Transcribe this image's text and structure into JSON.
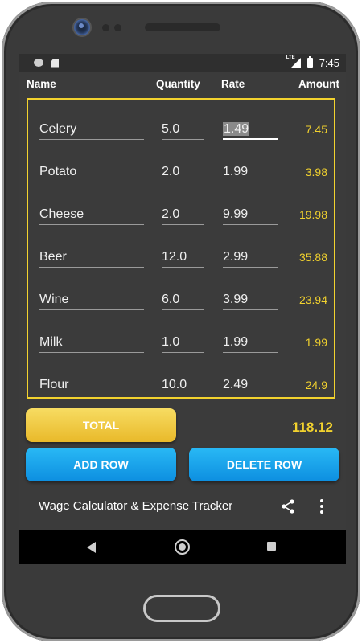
{
  "status_bar": {
    "time": "7:45",
    "signal": "LTE"
  },
  "columns": {
    "name": "Name",
    "quantity": "Quantity",
    "rate": "Rate",
    "amount": "Amount"
  },
  "rows": [
    {
      "name": "Celery",
      "quantity": "5.0",
      "rate": "1.49",
      "amount": "7.45"
    },
    {
      "name": "Potato",
      "quantity": "2.0",
      "rate": "1.99",
      "amount": "3.98"
    },
    {
      "name": "Cheese",
      "quantity": "2.0",
      "rate": "9.99",
      "amount": "19.98"
    },
    {
      "name": "Beer",
      "quantity": "12.0",
      "rate": "2.99",
      "amount": "35.88"
    },
    {
      "name": "Wine",
      "quantity": "6.0",
      "rate": "3.99",
      "amount": "23.94"
    },
    {
      "name": "Milk",
      "quantity": "1.0",
      "rate": "1.99",
      "amount": "1.99"
    },
    {
      "name": "Flour",
      "quantity": "10.0",
      "rate": "2.49",
      "amount": "24.9"
    }
  ],
  "total": {
    "button_label": "TOTAL",
    "value": "118.12"
  },
  "actions": {
    "add_row": "ADD ROW",
    "delete_row": "DELETE ROW"
  },
  "app_bar": {
    "title": "Wage Calculator & Expense Tracker",
    "share_icon": "share-icon",
    "more_icon": "more-vert-icon"
  },
  "colors": {
    "accent_yellow": "#f2d22e",
    "button_blue": "#1aa3ea",
    "background": "#3b3b3b"
  }
}
